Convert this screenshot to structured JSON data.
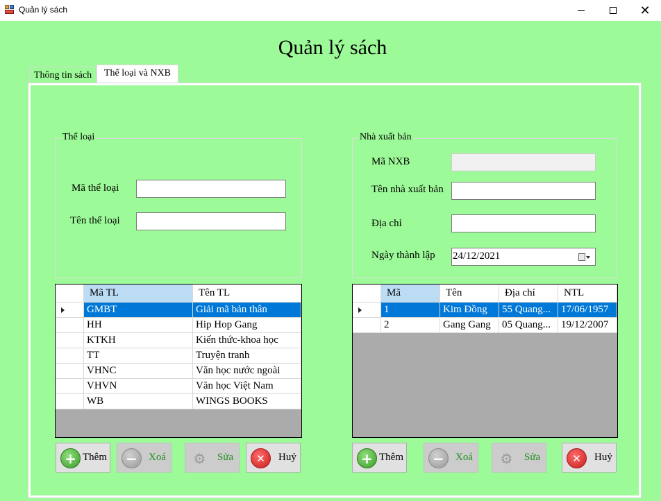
{
  "window": {
    "title": "Quản lý sách"
  },
  "heading": "Quản lý sách",
  "tabs": [
    {
      "label": "Thông tin sách",
      "selected": false
    },
    {
      "label": "Thể loại và NXB",
      "selected": true
    }
  ],
  "the_loai": {
    "group_title": "Thể loại",
    "ma_label": "Mã thể loại",
    "ma_value": "",
    "ten_label": "Tên thể loại",
    "ten_value": "",
    "grid": {
      "columns": [
        "Mã TL",
        "Tên TL"
      ],
      "rows": [
        [
          "GMBT",
          "Giải mã bản thân"
        ],
        [
          "HH",
          "Hip Hop Gang"
        ],
        [
          "KTKH",
          "Kiến thức-khoa học"
        ],
        [
          "TT",
          "Truyện tranh"
        ],
        [
          "VHNC",
          "Văn học nước ngoài"
        ],
        [
          "VHVN",
          "Văn học Việt Nam"
        ],
        [
          "WB",
          "WINGS BOOKS"
        ]
      ],
      "selected_row": 0
    },
    "buttons": {
      "add": "Thêm",
      "delete": "Xoá",
      "edit": "Sửa",
      "cancel": "Huỷ"
    }
  },
  "nxb": {
    "group_title": "Nhà xuất bản",
    "ma_label": "Mã NXB",
    "ma_value": "",
    "ten_label": "Tên nhà xuất bản",
    "ten_value": "",
    "diachi_label": "Địa chỉ",
    "diachi_value": "",
    "ngay_label": "Ngày thành lập",
    "ngay_value": "24/12/2021",
    "grid": {
      "columns": [
        "Mã",
        "Tên",
        "Địa chỉ",
        "NTL"
      ],
      "rows": [
        [
          "1",
          "Kim Đồng",
          "55 Quang...",
          "17/06/1957"
        ],
        [
          "2",
          "Gang Gang",
          "05 Quang...",
          "19/12/2007"
        ]
      ],
      "selected_row": 0
    },
    "buttons": {
      "add": "Thêm",
      "delete": "Xoá",
      "edit": "Sửa",
      "cancel": "Huỷ"
    }
  },
  "colors": {
    "background": "#9dfa98",
    "selection": "#0078d7",
    "sorted_header": "#bcdcf4"
  },
  "icons": {
    "add": "plus-circle-icon",
    "delete": "minus-circle-icon",
    "edit": "gear-icon",
    "cancel": "x-circle-icon"
  }
}
